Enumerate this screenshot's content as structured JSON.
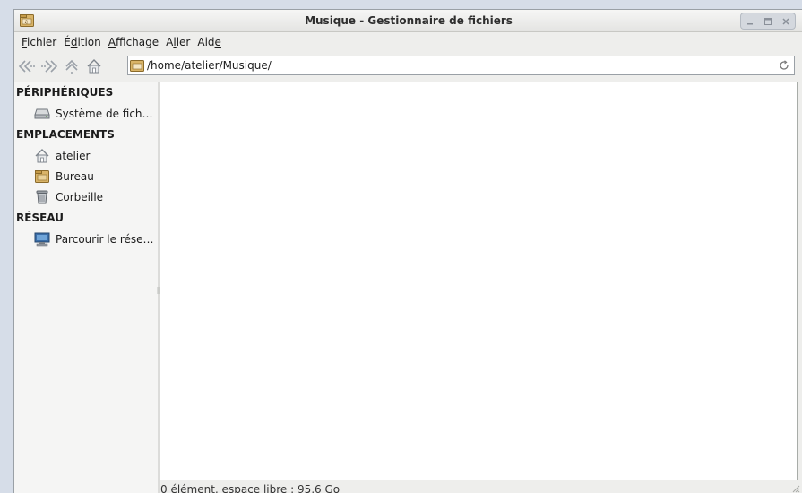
{
  "window": {
    "title": "Musique - Gestionnaire de fichiers",
    "icons": {
      "app": "folder-music-icon",
      "minimize": "minimize-icon",
      "maximize": "maximize-icon",
      "close": "close-icon"
    }
  },
  "menubar": {
    "fichier": {
      "mnemonic": "F",
      "rest": "ichier"
    },
    "edition": {
      "pre": "É",
      "mnemonic": "d",
      "rest": "ition"
    },
    "affichage": {
      "mnemonic": "A",
      "rest": "ffichage"
    },
    "aller": {
      "pre": "A",
      "mnemonic": "l",
      "rest": "ler"
    },
    "aide": {
      "pre": "Aid",
      "mnemonic": "e"
    }
  },
  "toolbar": {
    "location_path": "/home/atelier/Musique/",
    "icons": [
      "back-icon",
      "forward-icon",
      "up-icon",
      "home-icon",
      "folder-music-icon",
      "reload-icon"
    ]
  },
  "sidebar": {
    "sections": [
      {
        "title": "PÉRIPHÉRIQUES",
        "items": [
          {
            "label": "Système de fich…",
            "icon": "harddisk-icon"
          }
        ]
      },
      {
        "title": "EMPLACEMENTS",
        "items": [
          {
            "label": "atelier",
            "icon": "home-icon"
          },
          {
            "label": "Bureau",
            "icon": "desktop-folder-icon"
          },
          {
            "label": "Corbeille",
            "icon": "trash-icon"
          }
        ]
      },
      {
        "title": "RÉSEAU",
        "items": [
          {
            "label": "Parcourir le rése…",
            "icon": "network-icon"
          }
        ]
      }
    ]
  },
  "status": {
    "text": "0 élément, espace libre : 95,6 Go"
  },
  "colors": {
    "accent": "#c9a55a",
    "background": "#eeeeec",
    "desktop": "#d6dde8"
  }
}
